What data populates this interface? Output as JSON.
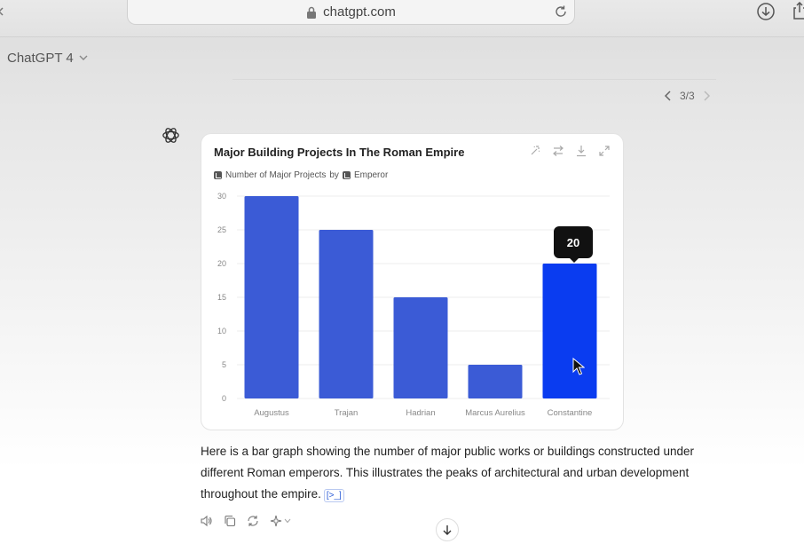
{
  "browser": {
    "url": "chatgpt.com"
  },
  "header": {
    "model_label": "ChatGPT 4"
  },
  "pager": {
    "label": "3/3"
  },
  "chart_card": {
    "title": "Major Building Projects In The Roman Empire",
    "subtitle_measure": "Number of Major Projects",
    "subtitle_by": "by",
    "subtitle_dimension": "Emperor",
    "tooltip_value": "20"
  },
  "chart_data": {
    "type": "bar",
    "title": "Major Building Projects In The Roman Empire",
    "categories": [
      "Augustus",
      "Trajan",
      "Hadrian",
      "Marcus Aurelius",
      "Constantine"
    ],
    "values": [
      30,
      25,
      15,
      5,
      20
    ],
    "ylim": [
      0,
      30
    ],
    "yticks": [
      0,
      5,
      10,
      15,
      20,
      25,
      30
    ],
    "grid": true,
    "highlighted_index": 4,
    "colors": {
      "bar": "#3b5bd6",
      "bar_highlight": "#0a3cf0",
      "grid": "#ececec",
      "tick_label": "#888888"
    }
  },
  "answer": {
    "text": "Here is a bar graph showing the number of major public works or buildings constructed under different Roman emperors. This illustrates the peaks of architectural and urban development throughout the empire.",
    "citation_label": "[>_]"
  },
  "icons": {
    "lock": "lock-icon",
    "reload": "reload-icon",
    "download": "download-icon",
    "share": "share-icon",
    "chatgpt_logo": "chatgpt-logo-icon"
  }
}
